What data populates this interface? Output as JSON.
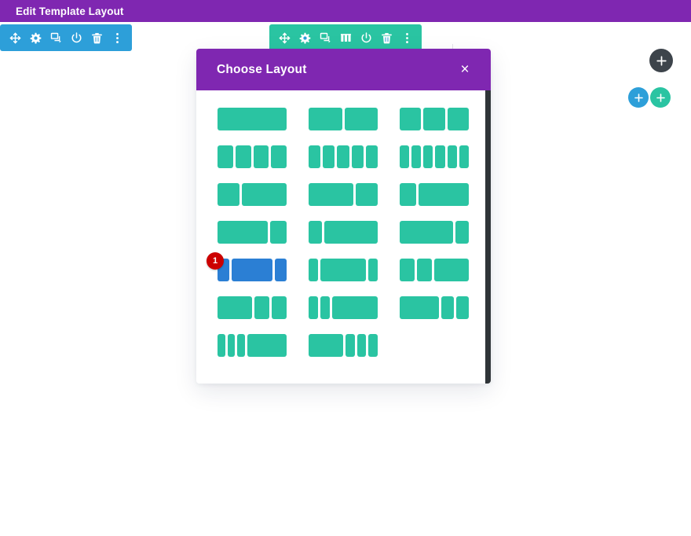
{
  "admin_bar": {
    "title": "Edit Template Layout"
  },
  "section_toolbar": {
    "color": "#2d9fd9",
    "buttons": [
      {
        "name": "move-icon",
        "label": "Move Section"
      },
      {
        "name": "gear-icon",
        "label": "Section Settings"
      },
      {
        "name": "duplicate-icon",
        "label": "Duplicate Section"
      },
      {
        "name": "power-icon",
        "label": "Disable Section"
      },
      {
        "name": "trash-icon",
        "label": "Delete Section"
      },
      {
        "name": "more-options-icon",
        "label": "Other Options"
      }
    ]
  },
  "row_toolbar": {
    "color": "#2ac4a2",
    "buttons": [
      {
        "name": "move-icon",
        "label": "Move Row"
      },
      {
        "name": "gear-icon",
        "label": "Row Settings"
      },
      {
        "name": "duplicate-icon",
        "label": "Duplicate Row"
      },
      {
        "name": "columns-icon",
        "label": "Change Column Structure",
        "active": true
      },
      {
        "name": "power-icon",
        "label": "Disable Row"
      },
      {
        "name": "trash-icon",
        "label": "Delete Row"
      },
      {
        "name": "more-options-icon",
        "label": "Other Options"
      }
    ]
  },
  "add_buttons": [
    {
      "name": "add-section-button",
      "label": "+",
      "color": "#3d444b"
    },
    {
      "name": "add-row-button",
      "label": "+",
      "color": "#2d9fd9"
    },
    {
      "name": "add-module-button",
      "label": "+",
      "color": "#2ac4a2"
    }
  ],
  "modal": {
    "title": "Choose Layout",
    "close_label": "×",
    "accent_color": "#7f27b1",
    "column_color": "#2ac4a2",
    "hover_color": "#2b7fd4",
    "badge": {
      "label": "1",
      "color": "#cc0000"
    },
    "layouts": [
      {
        "name": "layout-1-column",
        "widths": [
          100
        ]
      },
      {
        "name": "layout-2-columns",
        "widths": [
          50,
          50
        ]
      },
      {
        "name": "layout-3-columns",
        "widths": [
          33.33,
          33.33,
          33.33
        ]
      },
      {
        "name": "layout-4-columns",
        "widths": [
          25,
          25,
          25,
          25
        ]
      },
      {
        "name": "layout-5-columns",
        "widths": [
          20,
          20,
          20,
          20,
          20
        ]
      },
      {
        "name": "layout-6-columns",
        "widths": [
          16.66,
          16.66,
          16.66,
          16.66,
          16.66,
          16.66
        ]
      },
      {
        "name": "layout-third-twothirds",
        "widths": [
          33.33,
          66.66
        ]
      },
      {
        "name": "layout-twothirds-third",
        "widths": [
          66.66,
          33.33
        ]
      },
      {
        "name": "layout-quarter-threequarters",
        "widths": [
          25,
          75
        ]
      },
      {
        "name": "layout-threequarters-quarter",
        "widths": [
          75,
          25
        ]
      },
      {
        "name": "layout-quarter-threequarters-b",
        "widths": [
          20,
          80
        ]
      },
      {
        "name": "layout-threequarters-quarter-b",
        "widths": [
          80,
          20
        ]
      },
      {
        "name": "layout-quarter-half-quarter",
        "widths": [
          18,
          60,
          18
        ],
        "hovered": true
      },
      {
        "name": "layout-sixth-twothirds-sixth",
        "widths": [
          14,
          70,
          14
        ]
      },
      {
        "name": "layout-quarter-quarter-half",
        "widths": [
          22,
          22,
          52
        ]
      },
      {
        "name": "layout-half-quarter-quarter",
        "widths": [
          50,
          22,
          22
        ]
      },
      {
        "name": "layout-sixth-sixth-twothirds",
        "widths": [
          14,
          14,
          66
        ]
      },
      {
        "name": "layout-half-quarter-quarter-b",
        "widths": [
          56,
          18,
          18
        ]
      },
      {
        "name": "layout-three-sixths-half",
        "widths": [
          11,
          11,
          11,
          57
        ]
      },
      {
        "name": "layout-half-three-sixths",
        "widths": [
          50,
          13,
          13,
          13
        ]
      },
      {
        "name": "layout-empty-slot",
        "widths": [],
        "empty": true
      }
    ]
  }
}
